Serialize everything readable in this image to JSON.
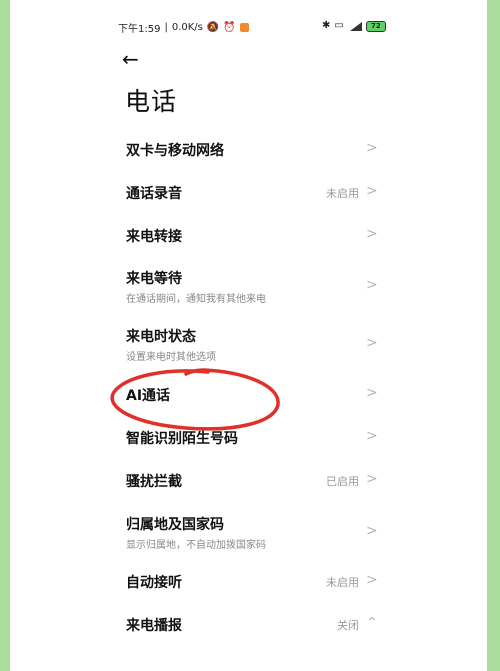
{
  "status": {
    "time": "下午1:59",
    "speed": "0.0K/s",
    "battery": "72"
  },
  "header": {
    "back_icon": "arrow-left-icon",
    "title": "电话"
  },
  "items": [
    {
      "label": "双卡与移动网络",
      "sub": "",
      "value": ""
    },
    {
      "label": "通话录音",
      "sub": "",
      "value": "未启用"
    },
    {
      "label": "来电转接",
      "sub": "",
      "value": ""
    },
    {
      "label": "来电等待",
      "sub": "在通话期间，通知我有其他来电",
      "value": ""
    },
    {
      "label": "来电时状态",
      "sub": "设置来电时其他选项",
      "value": ""
    },
    {
      "label": "AI通话",
      "sub": "",
      "value": ""
    },
    {
      "label": "智能识别陌生号码",
      "sub": "",
      "value": ""
    },
    {
      "label": "骚扰拦截",
      "sub": "",
      "value": "已启用"
    },
    {
      "label": "归属地及国家码",
      "sub": "显示归属地，不自动加拨国家码",
      "value": ""
    },
    {
      "label": "自动接听",
      "sub": "",
      "value": "未启用"
    },
    {
      "label": "来电播报",
      "sub": "",
      "value": "关闭"
    }
  ],
  "colors": {
    "background": "#a9dd9c",
    "annotation": "#e0302a"
  }
}
